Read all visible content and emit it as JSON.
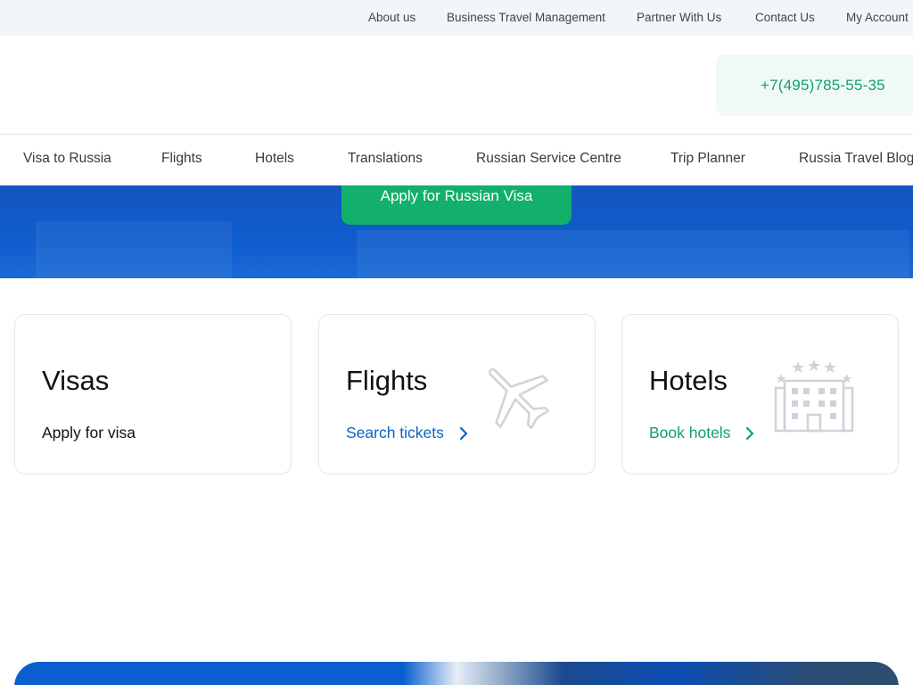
{
  "topbar": {
    "links": [
      "About us",
      "Business Travel Management",
      "Partner With Us",
      "Contact Us",
      "My Account"
    ]
  },
  "header": {
    "phone": "+7(495)785-55-35"
  },
  "nav": {
    "items": [
      "Visa to Russia",
      "Flights",
      "Hotels",
      "Translations",
      "Russian Service Centre",
      "Trip Planner",
      "Russia Travel Blog"
    ]
  },
  "hero": {
    "cta_label": "Apply for Russian Visa"
  },
  "cards": [
    {
      "title": "Visas",
      "link": "Apply for visa"
    },
    {
      "title": "Flights",
      "link": "Search tickets",
      "icon": "airplane-icon"
    },
    {
      "title": "Hotels",
      "link": "Book hotels",
      "icon": "hotel-building-icon"
    }
  ],
  "colors": {
    "accent_green": "#12b06b",
    "link_blue": "#0a63c9",
    "link_green": "#12a06a",
    "hero_blue": "#0f5ccc",
    "icon_gray": "#cfd3d9"
  }
}
